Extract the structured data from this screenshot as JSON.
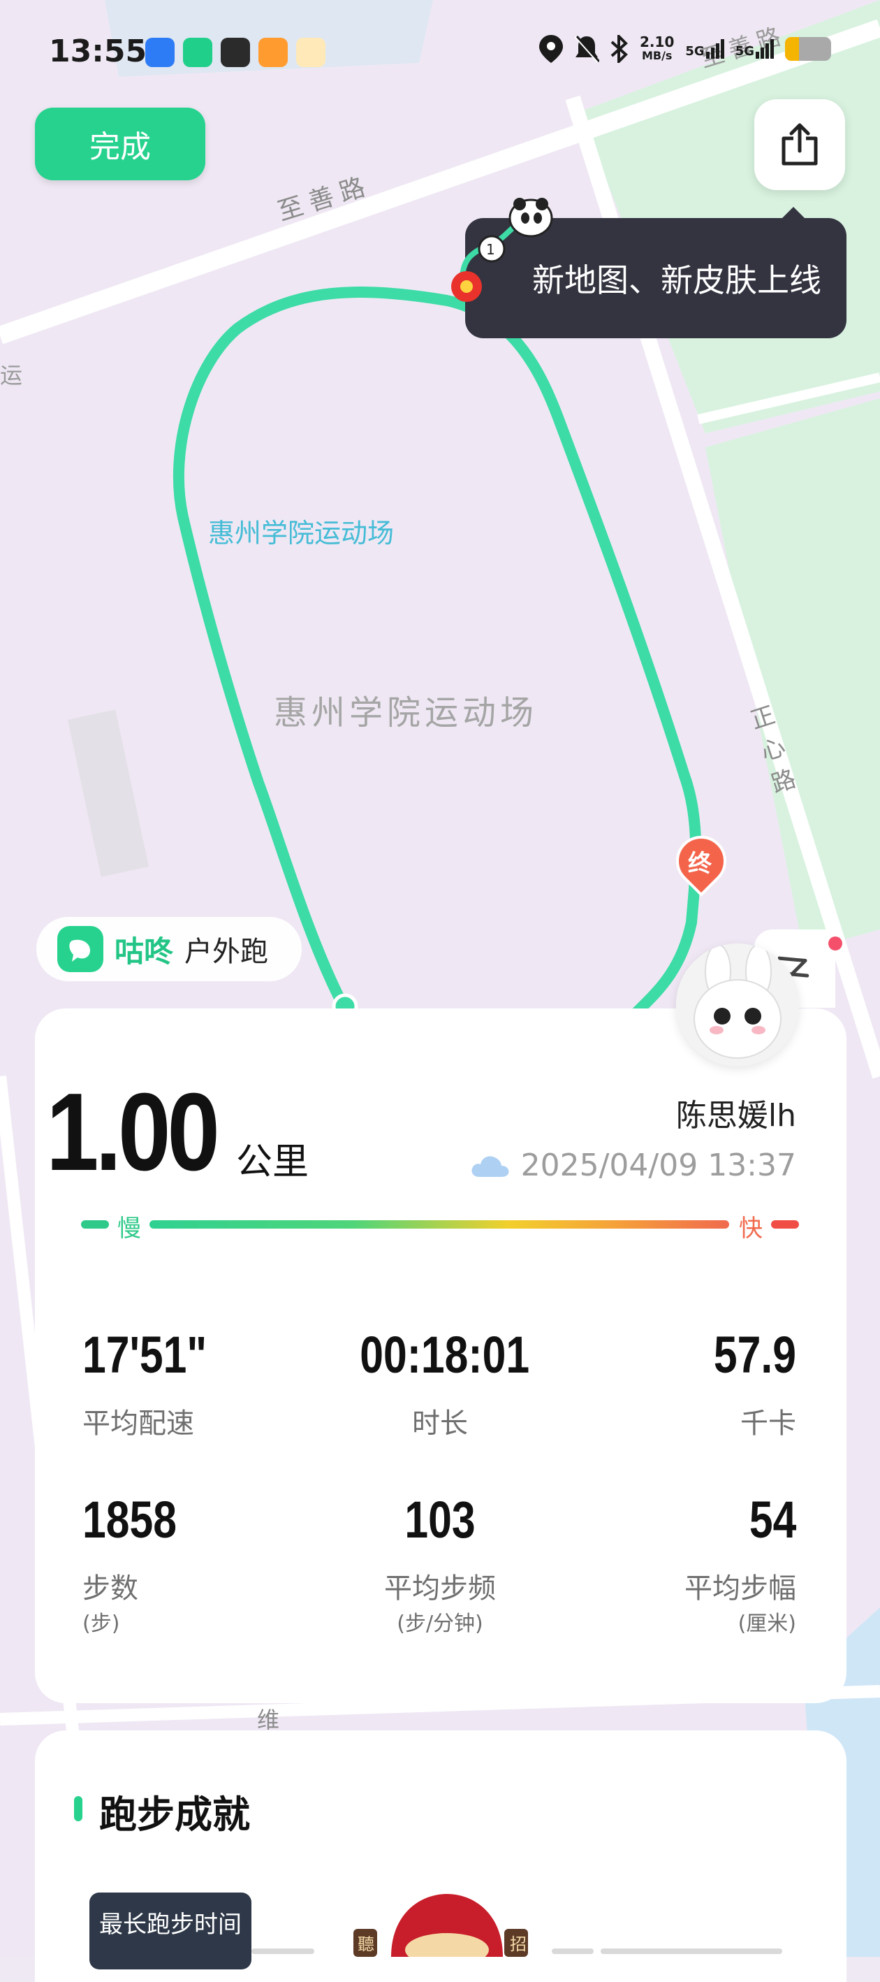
{
  "status_bar": {
    "time": "13:55",
    "net_speed_value": "2.10",
    "net_speed_unit": "MB/s",
    "sim1": "5G",
    "sim2": "5G",
    "battery_level": 0.3,
    "icons": [
      "location-icon",
      "mute-bell-icon",
      "bluetooth-icon"
    ]
  },
  "header": {
    "done_label": "完成",
    "tooltip_text": "新地图、新皮肤上线"
  },
  "map": {
    "road_top": "至善路",
    "road_top_right": "至善路",
    "road_right": "正心路",
    "road_left": "运",
    "road_bottom": "维",
    "venue_poi": "惠州学院运动场",
    "venue_area": "惠州学院运动场",
    "end_marker": "终",
    "route_color": "#3ddba6"
  },
  "brand": {
    "name": "咕咚",
    "activity": "户外跑"
  },
  "summary": {
    "distance": "1.00",
    "distance_unit": "公里",
    "user": "陈思媛lh",
    "datetime": "2025/04/09 13:37",
    "weather_icon": "cloud-icon",
    "pace_slow": "慢",
    "pace_fast": "快"
  },
  "stats": {
    "pace": {
      "value": "17'51\"",
      "label": "平均配速"
    },
    "duration": {
      "value": "00:18:01",
      "label": "时长"
    },
    "calories": {
      "value": "57.9",
      "label": "千卡"
    },
    "steps": {
      "value": "1858",
      "label": "步数",
      "unit": "(步)"
    },
    "cadence": {
      "value": "103",
      "label": "平均步频",
      "unit": "(步/分钟)"
    },
    "stride": {
      "value": "54",
      "label": "平均步幅",
      "unit": "(厘米)"
    }
  },
  "achievements": {
    "title": "跑步成就",
    "badge_label": "最长跑步时间",
    "medal_left": "聽",
    "medal_right": "招"
  },
  "colors": {
    "accent": "#27d28e",
    "tooltip_bg": "#343441",
    "end_marker": "#f4644b"
  }
}
